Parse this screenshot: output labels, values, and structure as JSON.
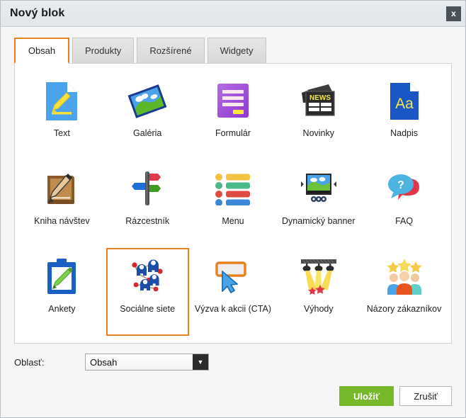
{
  "window": {
    "title": "Nový blok",
    "close_label": "x"
  },
  "tabs": [
    {
      "label": "Obsah",
      "active": true
    },
    {
      "label": "Produkty",
      "active": false
    },
    {
      "label": "Rozšírené",
      "active": false
    },
    {
      "label": "Widgety",
      "active": false
    }
  ],
  "blocks": [
    {
      "label": "Text",
      "icon": "text-document-pencil-icon",
      "selected": false
    },
    {
      "label": "Galéria",
      "icon": "gallery-photo-icon",
      "selected": false
    },
    {
      "label": "Formulár",
      "icon": "form-icon",
      "selected": false
    },
    {
      "label": "Novinky",
      "icon": "news-paper-icon",
      "selected": false
    },
    {
      "label": "Nadpis",
      "icon": "heading-aa-icon",
      "selected": false
    },
    {
      "label": "Kniha návštev",
      "icon": "guestbook-icon",
      "selected": false
    },
    {
      "label": "Rázcestník",
      "icon": "signpost-icon",
      "selected": false
    },
    {
      "label": "Menu",
      "icon": "menu-list-icon",
      "selected": false
    },
    {
      "label": "Dynamický banner",
      "icon": "dynamic-banner-icon",
      "selected": false
    },
    {
      "label": "FAQ",
      "icon": "faq-speech-bubbles-icon",
      "selected": false
    },
    {
      "label": "Ankety",
      "icon": "poll-clipboard-icon",
      "selected": false
    },
    {
      "label": "Sociálne siete",
      "icon": "social-network-icon",
      "selected": true
    },
    {
      "label": "Výzva k akcii (CTA)",
      "icon": "cta-cursor-icon",
      "selected": false
    },
    {
      "label": "Výhody",
      "icon": "spotlights-icon",
      "selected": false
    },
    {
      "label": "Názory zákazníkov",
      "icon": "customer-reviews-icon",
      "selected": false
    }
  ],
  "footer": {
    "area_label": "Oblasť:",
    "area_value": "Obsah",
    "area_options": [
      "Obsah"
    ],
    "save_label": "Uložiť",
    "cancel_label": "Zrušiť"
  },
  "colors": {
    "accent_orange": "#e8821e",
    "save_green": "#76b82a",
    "titlebar": "#e6e9ec",
    "close_btn": "#4a5159"
  }
}
